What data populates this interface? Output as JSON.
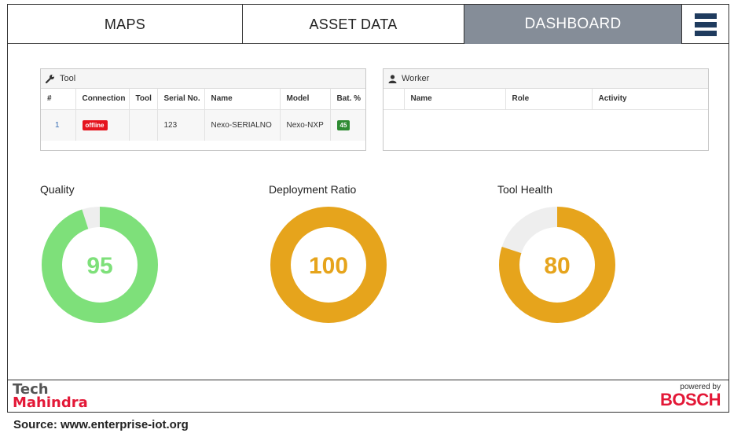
{
  "nav": {
    "tabs": [
      {
        "label": "MAPS",
        "active": false
      },
      {
        "label": "ASSET DATA",
        "active": false
      },
      {
        "label": "DASHBOARD",
        "active": true
      }
    ],
    "menu_icon": "hamburger-menu-icon",
    "active_color": "#858d98",
    "menu_color": "#1f3b5e"
  },
  "tool_panel": {
    "title": "Tool",
    "icon": "wrench-icon",
    "columns": [
      "#",
      "Connection",
      "Tool",
      "Serial No.",
      "Name",
      "Model",
      "Bat. %"
    ],
    "rows": [
      {
        "num": "1",
        "connection": "offline",
        "tool": "",
        "serial": "123",
        "name": "Nexo-SERIALNO",
        "model": "Nexo-NXP",
        "battery": "45"
      }
    ]
  },
  "worker_panel": {
    "title": "Worker",
    "icon": "user-icon",
    "columns": [
      "",
      "Name",
      "Role",
      "Activity"
    ]
  },
  "gauges": [
    {
      "title": "Quality",
      "value": 95,
      "display": "95",
      "max": 100,
      "color": "#7ee07a"
    },
    {
      "title": "Deployment Ratio",
      "value": 100,
      "display": "100",
      "max": 100,
      "color": "#e6a41c"
    },
    {
      "title": "Tool Health",
      "value": 80,
      "display": "80",
      "max": 100,
      "color": "#e6a41c"
    }
  ],
  "gauge_track_color": "#eeeeee",
  "footer": {
    "left_logo_line1": "Tech",
    "left_logo_line2": "Mahindra",
    "right_powered": "powered by",
    "right_brand": "BOSCH"
  },
  "source": "Source: www.enterprise-iot.org"
}
